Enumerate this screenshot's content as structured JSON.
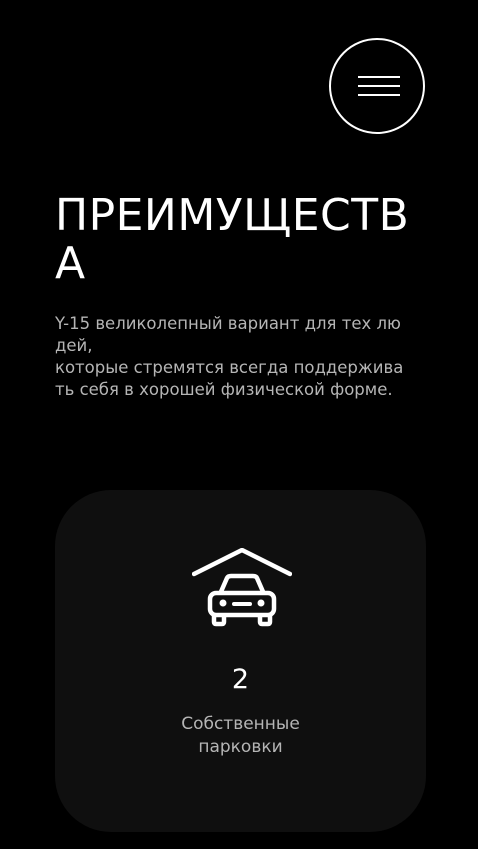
{
  "header": {
    "menu_icon": "hamburger-menu-icon"
  },
  "section": {
    "title": "ПРЕИМУЩЕСТВА",
    "description_lines": [
      "Y-15 великолепный вариант для тех лю дей,",
      "которые стремятся всегда поддержива",
      "ть себя в хорошей физической форме."
    ]
  },
  "card": {
    "icon": "garage-car-icon",
    "value": "2",
    "label_lines": [
      "Собственные",
      "парковки"
    ]
  },
  "colors": {
    "background": "#000000",
    "card_background": "#0f0f0f",
    "text_primary": "#ffffff",
    "text_secondary": "#b5b5b5"
  }
}
